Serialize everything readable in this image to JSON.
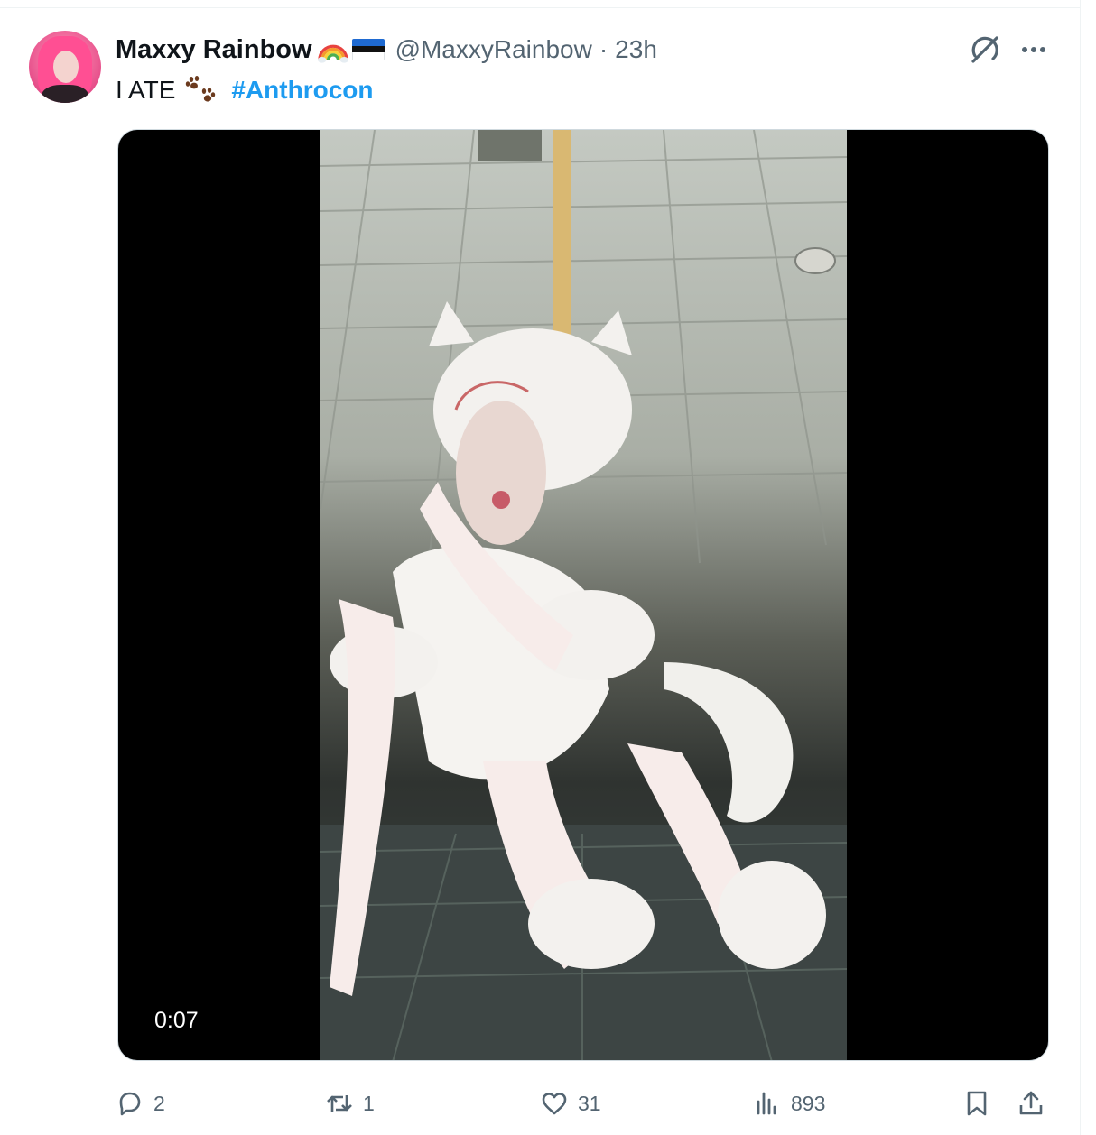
{
  "tweet": {
    "author": {
      "display_name": "Maxxy Rainbow",
      "handle": "@MaxxyRainbow",
      "avatar_icon": "avatar-photo",
      "emojis": [
        "rainbow-icon",
        "estonia-flag-icon"
      ]
    },
    "separator": "·",
    "time": "23h",
    "text": "I ATE",
    "text_emoji": "paw-prints-icon",
    "hashtag": "#Anthrocon",
    "media": {
      "type": "video",
      "duration": "0:07"
    },
    "actions": {
      "reply_count": "2",
      "retweet_count": "1",
      "like_count": "31",
      "views_count": "893"
    },
    "header_icons": [
      "grok-icon",
      "more-icon"
    ]
  },
  "colors": {
    "accent": "#1d9bf0",
    "text": "#0f1419",
    "muted": "#536471",
    "divider": "#eff3f4"
  }
}
